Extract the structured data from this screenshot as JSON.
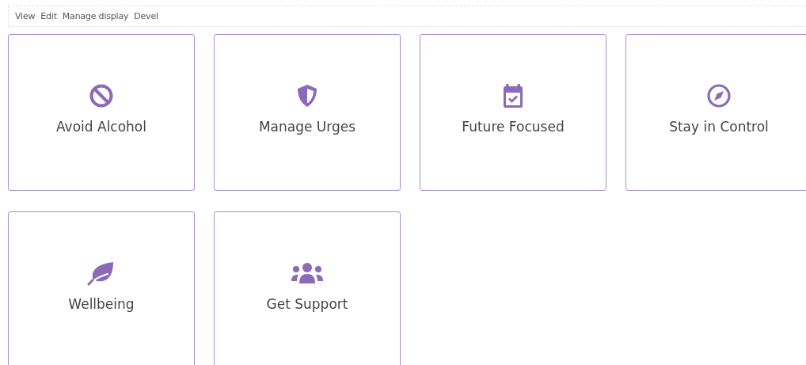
{
  "tabs": [
    {
      "label": "View"
    },
    {
      "label": "Edit"
    },
    {
      "label": "Manage display"
    },
    {
      "label": "Devel"
    }
  ],
  "cards": [
    {
      "label": "Avoid Alcohol"
    },
    {
      "label": "Manage Urges"
    },
    {
      "label": "Future Focused"
    },
    {
      "label": "Stay in Control"
    },
    {
      "label": "Wellbeing"
    },
    {
      "label": "Get Support"
    }
  ]
}
